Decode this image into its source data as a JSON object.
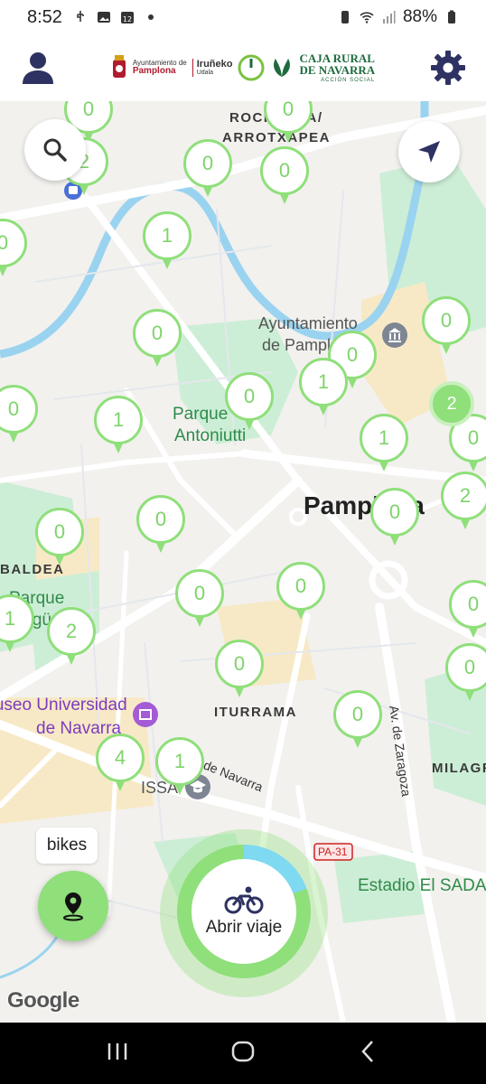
{
  "status_bar": {
    "time": "8:52",
    "battery": "88%"
  },
  "header": {
    "profile_icon": "person-icon",
    "settings_icon": "gear-icon",
    "logos": {
      "ayuntamiento_line1": "Ayuntamiento de",
      "ayuntamiento_line2": "Pamplona",
      "irunea_line1": "Iruñeko",
      "irunea_line2": "Udala",
      "caja_line1": "CAJA RURAL",
      "caja_line2": "DE NAVARRA",
      "caja_line3": "ACCIÓN SOCIAL"
    }
  },
  "map": {
    "labels": {
      "rochapea": "ROCHAPEA/",
      "arrotxapea": "ARROTXAPEA",
      "ayuntamiento": "Ayuntamiento",
      "de_pamplona": "de Pamplona",
      "parque_antoniutti_1": "Parque",
      "parque_antoniutti_2": "Antoniutti",
      "pamplona_city": "Pamplona",
      "baldea": "BALDEA",
      "parque_left_1": "Parque",
      "parque_left_2": "Yagüe",
      "museo_1": "Museo Universidad",
      "museo_2": "de Navarra",
      "iturrama": "ITURRAMA",
      "av_navarra": "Av. de Navarra",
      "av_zaragoza": "Av. de Zaragoza",
      "issa": "ISSA",
      "pa31": "PA-31",
      "estadio": "Estadio El SADAR",
      "mila": "MILAGROSA"
    },
    "stations": [
      {
        "count": "0"
      },
      {
        "count": "2"
      },
      {
        "count": "0"
      },
      {
        "count": "0"
      },
      {
        "count": "0"
      },
      {
        "count": "1"
      },
      {
        "count": "0"
      },
      {
        "count": "0"
      },
      {
        "count": "0"
      },
      {
        "count": "1"
      },
      {
        "count": "0"
      },
      {
        "count": "1"
      },
      {
        "count": "1"
      },
      {
        "count": "0"
      },
      {
        "count": "0"
      },
      {
        "count": "0"
      },
      {
        "count": "2"
      },
      {
        "count": "0"
      },
      {
        "count": "0"
      },
      {
        "count": "0"
      },
      {
        "count": "1"
      },
      {
        "count": "2"
      },
      {
        "count": "0"
      },
      {
        "count": "0"
      },
      {
        "count": "0"
      },
      {
        "count": "4"
      },
      {
        "count": "1"
      }
    ],
    "cluster": "2"
  },
  "controls": {
    "search_icon": "search-icon",
    "locate_icon": "navigation-arrow-icon",
    "bikes_chip": "bikes",
    "bikes_fab_icon": "location-pin-icon",
    "trip_icon": "bicycle-icon",
    "trip_label": "Abrir viaje"
  },
  "google_attribution": "Google",
  "nav_bar": {
    "recents_icon": "recents-icon",
    "home_icon": "home-icon",
    "back_icon": "back-icon"
  },
  "colors": {
    "accent_green": "#8fdf7a",
    "header_icon": "#2e3262",
    "park_green": "#c8ecd0"
  }
}
